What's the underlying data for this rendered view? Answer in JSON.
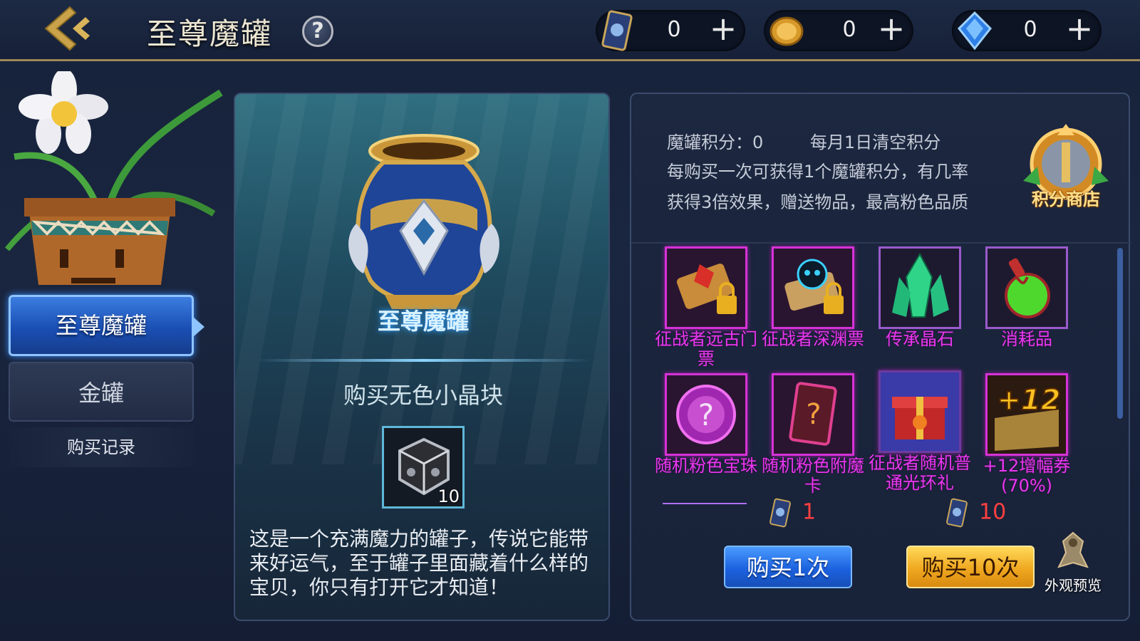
{
  "header": {
    "title": "至尊魔罐",
    "help_label": "?",
    "currencies": [
      {
        "icon": "ticket-card-icon",
        "value": "0",
        "plus": "+"
      },
      {
        "icon": "gold-coin-icon",
        "value": "0",
        "plus": "+"
      },
      {
        "icon": "blue-diamond-icon",
        "value": "0",
        "plus": "+"
      }
    ]
  },
  "sidebar": {
    "tabs": [
      {
        "label": "至尊魔罐",
        "active": true
      },
      {
        "label": "金罐",
        "active": false
      }
    ],
    "record_label": "购买记录"
  },
  "center": {
    "jar_name": "至尊魔罐",
    "buy_item_label": "购买无色小晶块",
    "item_count": "10",
    "description": "这是一个充满魔力的罐子，传说它能带来好运气，至于罐子里面藏着什么样的宝贝，你只有打开它才知道！"
  },
  "right": {
    "points_label": "魔罐积分：0",
    "points_reset": "每月1日清空积分",
    "points_desc": "每购买一次可获得1个魔罐积分，有几率获得3倍效果，赠送物品，最高粉色品质",
    "shop_label": "积分商店",
    "rewards": [
      {
        "name": "征战者远古门票",
        "icon": "scroll-lock-icon"
      },
      {
        "name": "征战者深渊票",
        "icon": "skull-scroll-lock-icon"
      },
      {
        "name": "传承晶石",
        "icon": "green-crystal-icon"
      },
      {
        "name": "消耗品",
        "icon": "green-potion-icon"
      },
      {
        "name": "随机粉色宝珠",
        "icon": "pink-orb-icon"
      },
      {
        "name": "随机粉色附魔卡",
        "icon": "pink-card-icon"
      },
      {
        "name": "征战者随机普通光环礼",
        "icon": "gift-box-icon"
      },
      {
        "name": "+12增幅券(70%)",
        "icon": "amplify-ticket-icon"
      }
    ],
    "price_one": "1",
    "price_ten": "10",
    "buy_one_label": "购买1次",
    "buy_ten_label": "购买10次",
    "preview_label": "外观预览"
  }
}
